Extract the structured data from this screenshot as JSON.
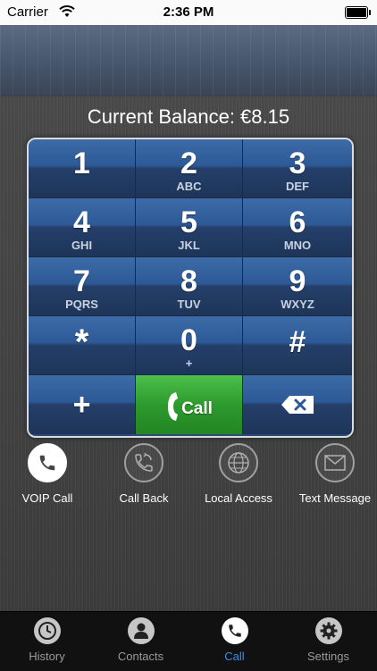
{
  "status": {
    "carrier": "Carrier",
    "time": "2:36 PM"
  },
  "balance": {
    "text": "Current Balance: €8.15"
  },
  "keypad": {
    "keys": [
      {
        "digit": "1",
        "letters": ""
      },
      {
        "digit": "2",
        "letters": "ABC"
      },
      {
        "digit": "3",
        "letters": "DEF"
      },
      {
        "digit": "4",
        "letters": "GHI"
      },
      {
        "digit": "5",
        "letters": "JKL"
      },
      {
        "digit": "6",
        "letters": "MNO"
      },
      {
        "digit": "7",
        "letters": "PQRS"
      },
      {
        "digit": "8",
        "letters": "TUV"
      },
      {
        "digit": "9",
        "letters": "WXYZ"
      },
      {
        "digit": "*",
        "letters": ""
      },
      {
        "digit": "0",
        "letters": "+"
      },
      {
        "digit": "#",
        "letters": ""
      }
    ],
    "plus": "+",
    "call_label": "Call"
  },
  "modes": [
    {
      "label": "VOIP Call",
      "icon": "phone-icon",
      "active": true
    },
    {
      "label": "Call Back",
      "icon": "callback-icon",
      "active": false
    },
    {
      "label": "Local Access",
      "icon": "globe-icon",
      "active": false
    },
    {
      "label": "Text Message",
      "icon": "envelope-icon",
      "active": false
    }
  ],
  "tabs": [
    {
      "label": "History",
      "icon": "clock-icon",
      "active": false
    },
    {
      "label": "Contacts",
      "icon": "person-icon",
      "active": false
    },
    {
      "label": "Call",
      "icon": "phone-icon",
      "active": true
    },
    {
      "label": "Settings",
      "icon": "gear-icon",
      "active": false
    }
  ],
  "colors": {
    "accent": "#3a8ee6",
    "call_green": "#2d9a2d",
    "keypad_blue": "#2d5a96"
  }
}
